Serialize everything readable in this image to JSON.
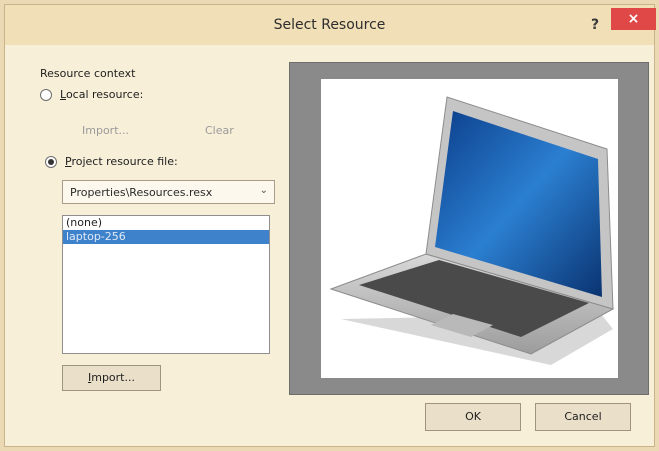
{
  "window": {
    "title": "Select Resource",
    "help": "?",
    "close": "×"
  },
  "resource_context": {
    "group_label": "Resource context",
    "local_radio": {
      "accel": "L",
      "rest": "ocal resource:",
      "checked": false
    },
    "import_link": "Import...",
    "clear_link": "Clear",
    "project_radio": {
      "accel": "P",
      "rest": "roject resource file:",
      "checked": true
    },
    "file_select": {
      "value": "Properties\\Resources.resx",
      "arrow": "⌄"
    },
    "list": [
      {
        "label": "(none)",
        "selected": false
      },
      {
        "label": "laptop-256",
        "selected": true
      }
    ],
    "import_button": {
      "accel": "I",
      "rest": "mport..."
    }
  },
  "preview": {
    "image_icon": "laptop-icon"
  },
  "footer": {
    "ok": "OK",
    "cancel": "Cancel"
  }
}
